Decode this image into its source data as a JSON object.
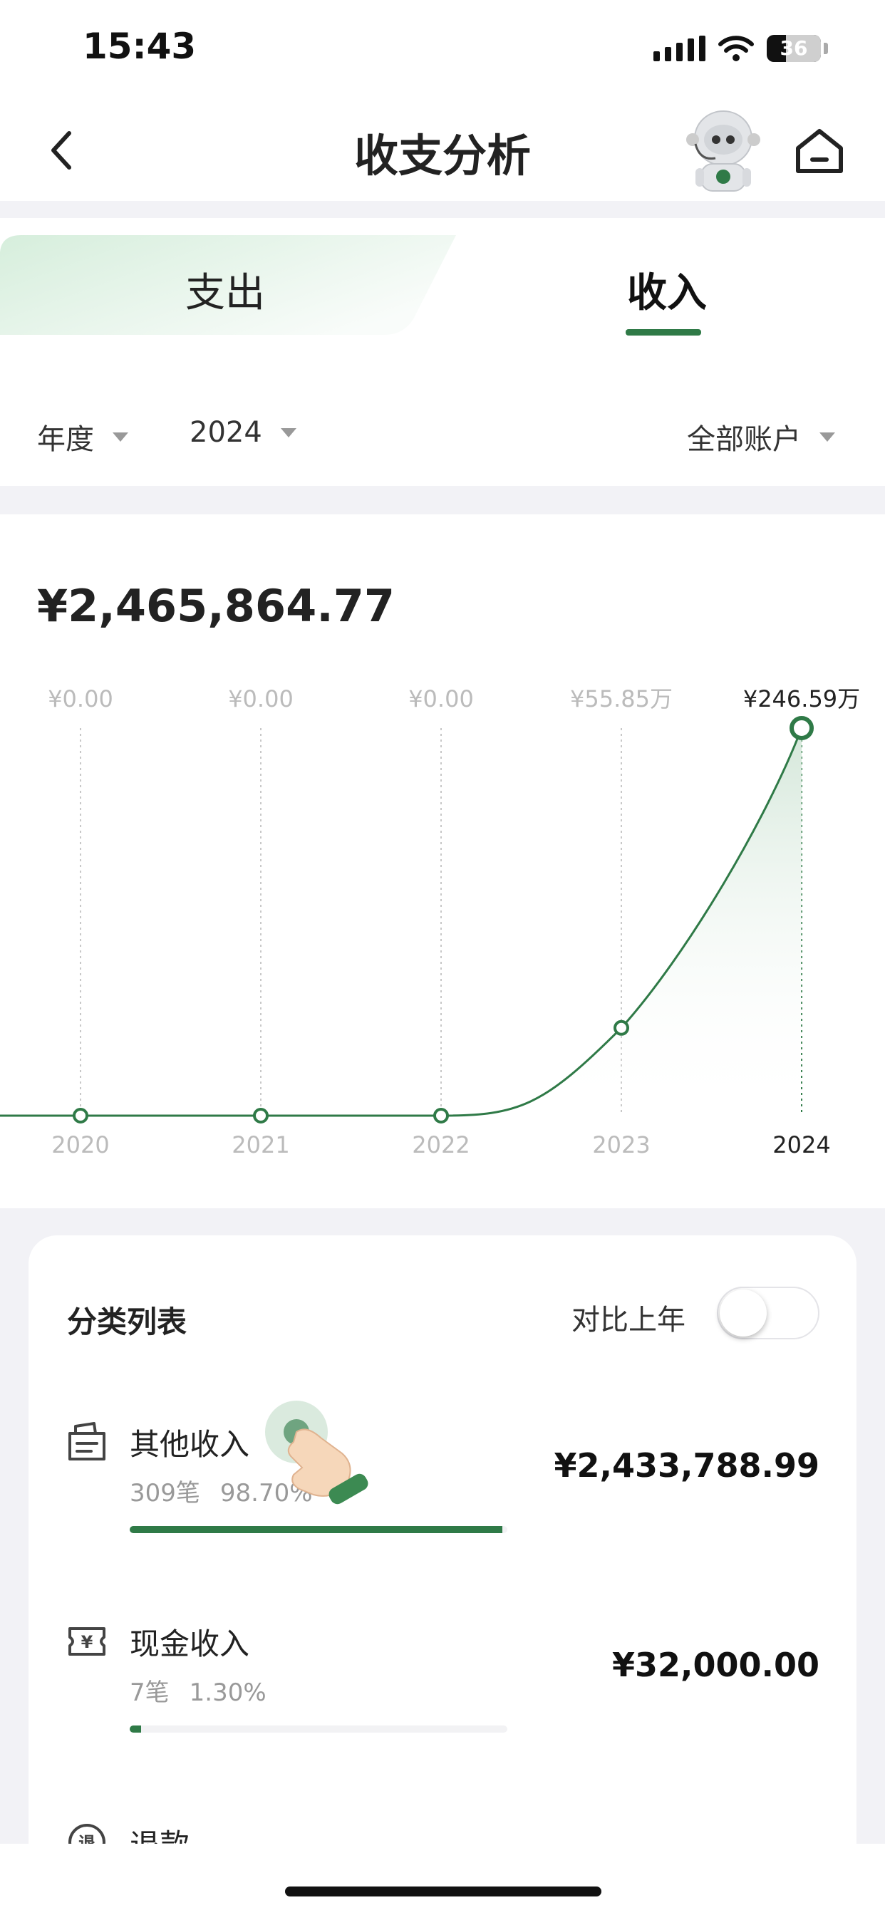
{
  "status_bar": {
    "time": "15:43",
    "battery": "36"
  },
  "header": {
    "title": "收支分析"
  },
  "tabs": [
    {
      "label": "支出",
      "selected": false
    },
    {
      "label": "收入",
      "selected": true
    }
  ],
  "filters": {
    "period": "年度",
    "year": "2024",
    "account": "全部账户"
  },
  "summary": {
    "total": "¥2,465,864.77"
  },
  "chart_data": {
    "type": "line",
    "categories": [
      "2020",
      "2021",
      "2022",
      "2023",
      "2024"
    ],
    "series": [
      {
        "values": [
          0,
          0,
          0,
          558500,
          2465900
        ]
      }
    ],
    "data_labels": [
      "¥0.00",
      "¥0.00",
      "¥0.00",
      "¥55.85万",
      "¥246.59万"
    ],
    "selected_index": 4,
    "color": "#2f7a47"
  },
  "category_list": {
    "title": "分类列表",
    "compare_label": "对比上年",
    "compare_enabled": false,
    "items": [
      {
        "name": "其他收入",
        "count": "309笔",
        "percent": "98.70%",
        "amount": "¥2,433,788.99",
        "ratio": 0.987,
        "icon": "receipt-icon"
      },
      {
        "name": "现金收入",
        "count": "7笔",
        "percent": "1.30%",
        "amount": "¥32,000.00",
        "ratio": 0.013,
        "icon": "cash-icon"
      },
      {
        "name": "退款",
        "icon": "refund-icon"
      }
    ]
  },
  "colors": {
    "accent": "#2f7a47",
    "background": "#f2f2f6"
  }
}
